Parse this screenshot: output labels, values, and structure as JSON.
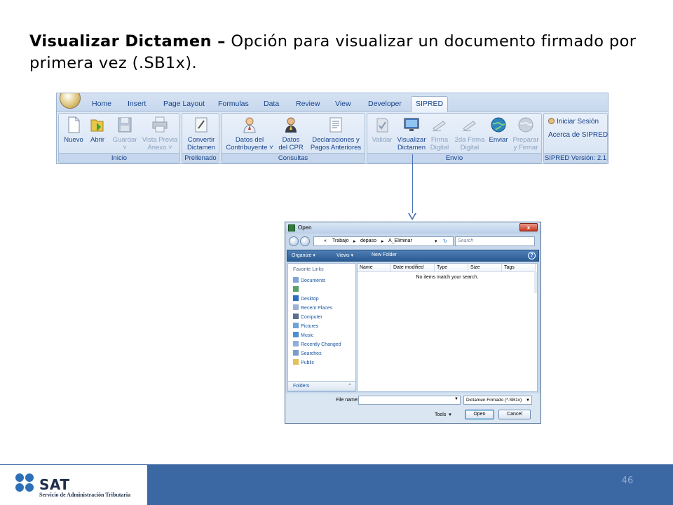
{
  "slide": {
    "title_bold": "Visualizar Dictamen –",
    "title_rest": " Opción para visualizar un documento firmado por primera vez (.SB1x).",
    "page_number": "46"
  },
  "ribbon": {
    "tabs": [
      "Home",
      "Insert",
      "Page Layout",
      "Formulas",
      "Data",
      "Review",
      "View",
      "Developer",
      "SIPRED"
    ],
    "active_tab": "SIPRED",
    "groups": {
      "inicio": {
        "label": "Inicio",
        "buttons": [
          {
            "line1": "Nuevo",
            "line2": "",
            "icon": "new-document-icon",
            "enabled": true
          },
          {
            "line1": "Abrir",
            "line2": "",
            "icon": "open-folder-icon",
            "enabled": true
          },
          {
            "line1": "Guardar",
            "line2": "˅",
            "icon": "save-disk-icon",
            "enabled": false
          },
          {
            "line1": "Vista Previa",
            "line2": "Anexo ˅",
            "icon": "print-preview-icon",
            "enabled": false
          }
        ]
      },
      "prellenado": {
        "label": "Prellenado",
        "buttons": [
          {
            "line1": "Convertir",
            "line2": "Dictamen",
            "icon": "convert-icon",
            "enabled": true
          }
        ]
      },
      "consultas": {
        "label": "Consultas",
        "buttons": [
          {
            "line1": "Datos del",
            "line2": "Contribuyente ˅",
            "icon": "taxpayer-person-icon",
            "enabled": true
          },
          {
            "line1": "Datos",
            "line2": "del CPR ˅",
            "icon": "cpr-person-icon",
            "enabled": true
          },
          {
            "line1": "Declaraciones y",
            "line2": "Pagos Anteriores",
            "icon": "document-list-icon",
            "enabled": true
          }
        ]
      },
      "envio": {
        "label": "Envío",
        "buttons": [
          {
            "line1": "Validar",
            "line2": "",
            "icon": "validate-icon",
            "enabled": false
          },
          {
            "line1": "Visualizar",
            "line2": "Dictamen",
            "icon": "monitor-icon",
            "enabled": true
          },
          {
            "line1": "Firma",
            "line2": "Digital",
            "icon": "pen-sign-icon",
            "enabled": false
          },
          {
            "line1": "2da Firma",
            "line2": "Digital",
            "icon": "pen-sign-2-icon",
            "enabled": false
          },
          {
            "line1": "Enviar",
            "line2": "",
            "icon": "globe-send-icon",
            "enabled": true
          },
          {
            "line1": "Preparar",
            "line2": "y Firmar",
            "icon": "globe-prepare-icon",
            "enabled": false
          }
        ]
      },
      "sipred": {
        "label": "SIPRED Versión: 2.1",
        "links": [
          "Iniciar Sesión",
          "Acerca de SIPRED"
        ]
      }
    }
  },
  "dialog": {
    "title": "Open",
    "close_label": "x",
    "breadcrumb": [
      "«",
      "Trabajo",
      "depaso",
      "A_Eliminar"
    ],
    "search_placeholder": "Search",
    "toolbar": {
      "organize": "Organize",
      "views": "Views",
      "new_folder": "New Folder",
      "help": "?"
    },
    "nav_header": "Favorite Links",
    "nav_links": [
      "Documents",
      "",
      "Desktop",
      "Recent Places",
      "Computer",
      "Pictures",
      "Music",
      "Recently Changed",
      "Searches",
      "Public"
    ],
    "folders_label": "Folders",
    "columns": [
      "Name",
      "Date modified",
      "Type",
      "Size",
      "Tags"
    ],
    "empty_message": "No items match your search.",
    "file_name_label": "File name:",
    "file_name_value": "",
    "filter_value": "Dictamen Firmado (*.SB1x)",
    "tools_label": "Tools",
    "open_label": "Open",
    "cancel_label": "Cancel"
  },
  "footer": {
    "brand": "SAT",
    "brand_sub": "Servicio de Administración Tributaria"
  },
  "colors": {
    "ribbon_text": "#15428b",
    "footer_blue": "#3b68a3",
    "arrow": "#4a6fb5"
  }
}
